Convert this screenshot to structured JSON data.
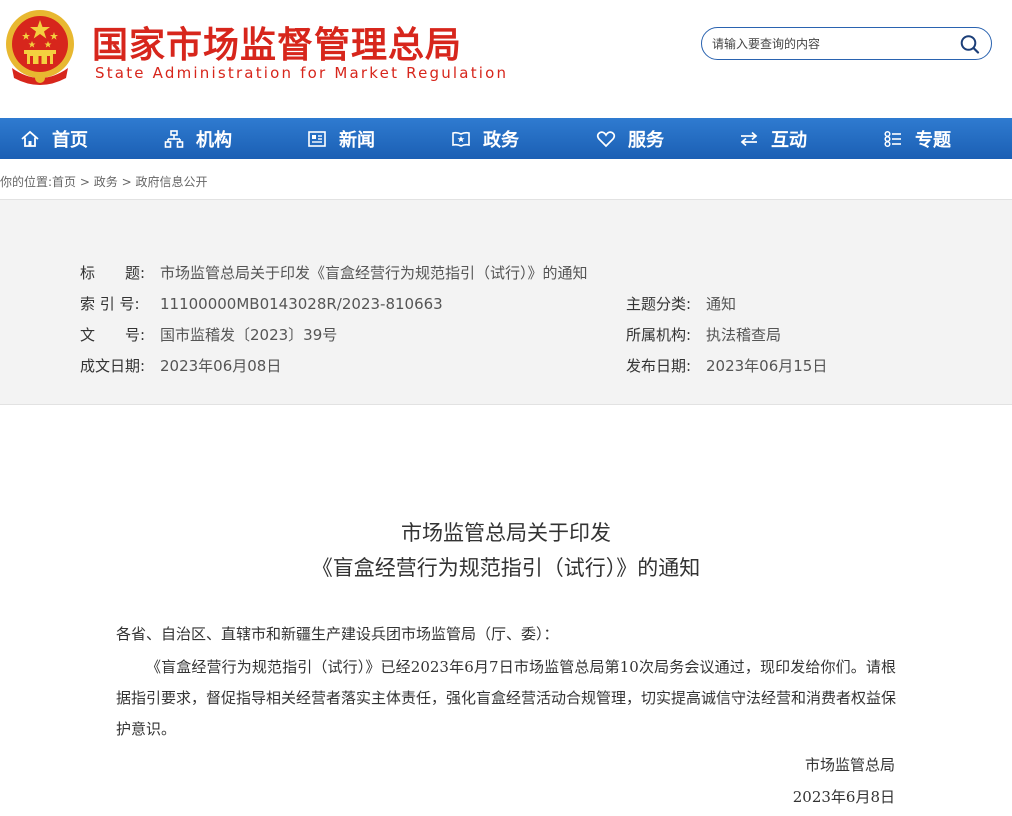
{
  "header": {
    "title_cn": "国家市场监督管理总局",
    "title_en": "State Administration for Market Regulation",
    "search_placeholder": "请输入要查询的内容"
  },
  "nav": {
    "items": [
      {
        "label": "首页",
        "icon": "home-icon"
      },
      {
        "label": "机构",
        "icon": "org-chart-icon"
      },
      {
        "label": "新闻",
        "icon": "newspaper-icon"
      },
      {
        "label": "政务",
        "icon": "shield-book-icon"
      },
      {
        "label": "服务",
        "icon": "heart-icon"
      },
      {
        "label": "互动",
        "icon": "exchange-arrows-icon"
      },
      {
        "label": "专题",
        "icon": "topic-list-icon"
      }
    ]
  },
  "breadcrumb": {
    "prefix": "你的位置:",
    "items": [
      "首页",
      "政务",
      "政府信息公开"
    ],
    "separator": ">"
  },
  "meta": {
    "title_label": "标　　题:",
    "title_value": "市场监管总局关于印发《盲盒经营行为规范指引（试行）》的通知",
    "index_label": "索 引 号:",
    "index_value": "11100000MB0143028R/2023-810663",
    "topic_label": "主题分类:",
    "topic_value": "通知",
    "doc_label": "文　　号:",
    "doc_value": "国市监稽发〔2023〕39号",
    "org_label": "所属机构:",
    "org_value": "执法稽查局",
    "created_label": "成文日期:",
    "created_value": "2023年06月08日",
    "published_label": "发布日期:",
    "published_value": "2023年06月15日"
  },
  "article": {
    "title_line1": "市场监管总局关于印发",
    "title_line2": "《盲盒经营行为规范指引（试行）》的通知",
    "salutation": "各省、自治区、直辖市和新疆生产建设兵团市场监管局（厅、委）：",
    "paragraph": "《盲盒经营行为规范指引（试行）》已经2023年6月7日市场监管总局第10次局务会议通过，现印发给你们。请根据指引要求，督促指导相关经营者落实主体责任，强化盲盒经营活动合规管理，切实提高诚信守法经营和消费者权益保护意识。",
    "signature": "市场监管总局",
    "date": "2023年6月8日"
  },
  "colors": {
    "brand_red": "#d7261c",
    "nav_blue": "#1b5fb4",
    "search_border": "#2a63b0"
  }
}
